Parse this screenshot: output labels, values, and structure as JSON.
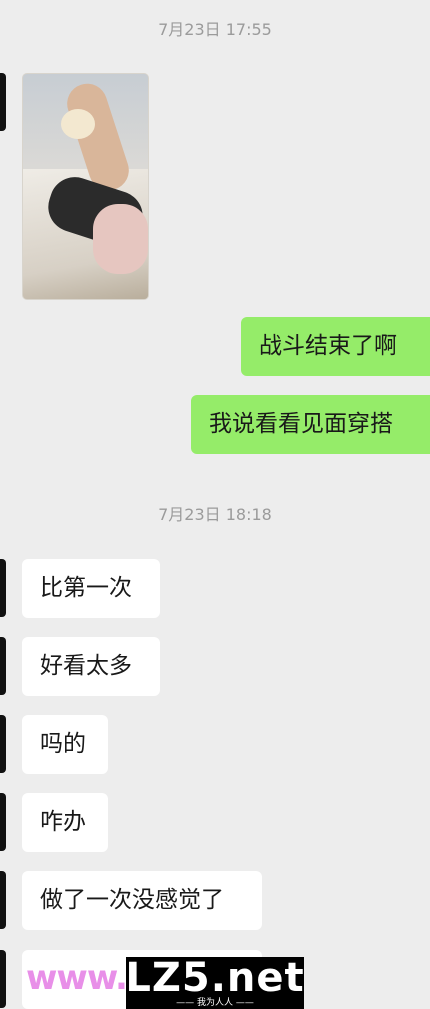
{
  "timestamps": [
    "7月23日 17:55",
    "7月23日 18:18"
  ],
  "messages": {
    "out_1": "战斗结束了啊",
    "out_2": "我说看看见面穿搭",
    "in_1": "比第一次",
    "in_2": "好看太多",
    "in_3": "吗的",
    "in_4": "咋办",
    "in_5": "做了一次没感觉了"
  },
  "watermark": {
    "left_text": "www.",
    "brand": "LZ5.net",
    "tagline": "—— 我为人人 ——"
  },
  "colors": {
    "background": "#ededed",
    "outgoing_bubble": "#95ec69",
    "incoming_bubble": "#ffffff"
  }
}
